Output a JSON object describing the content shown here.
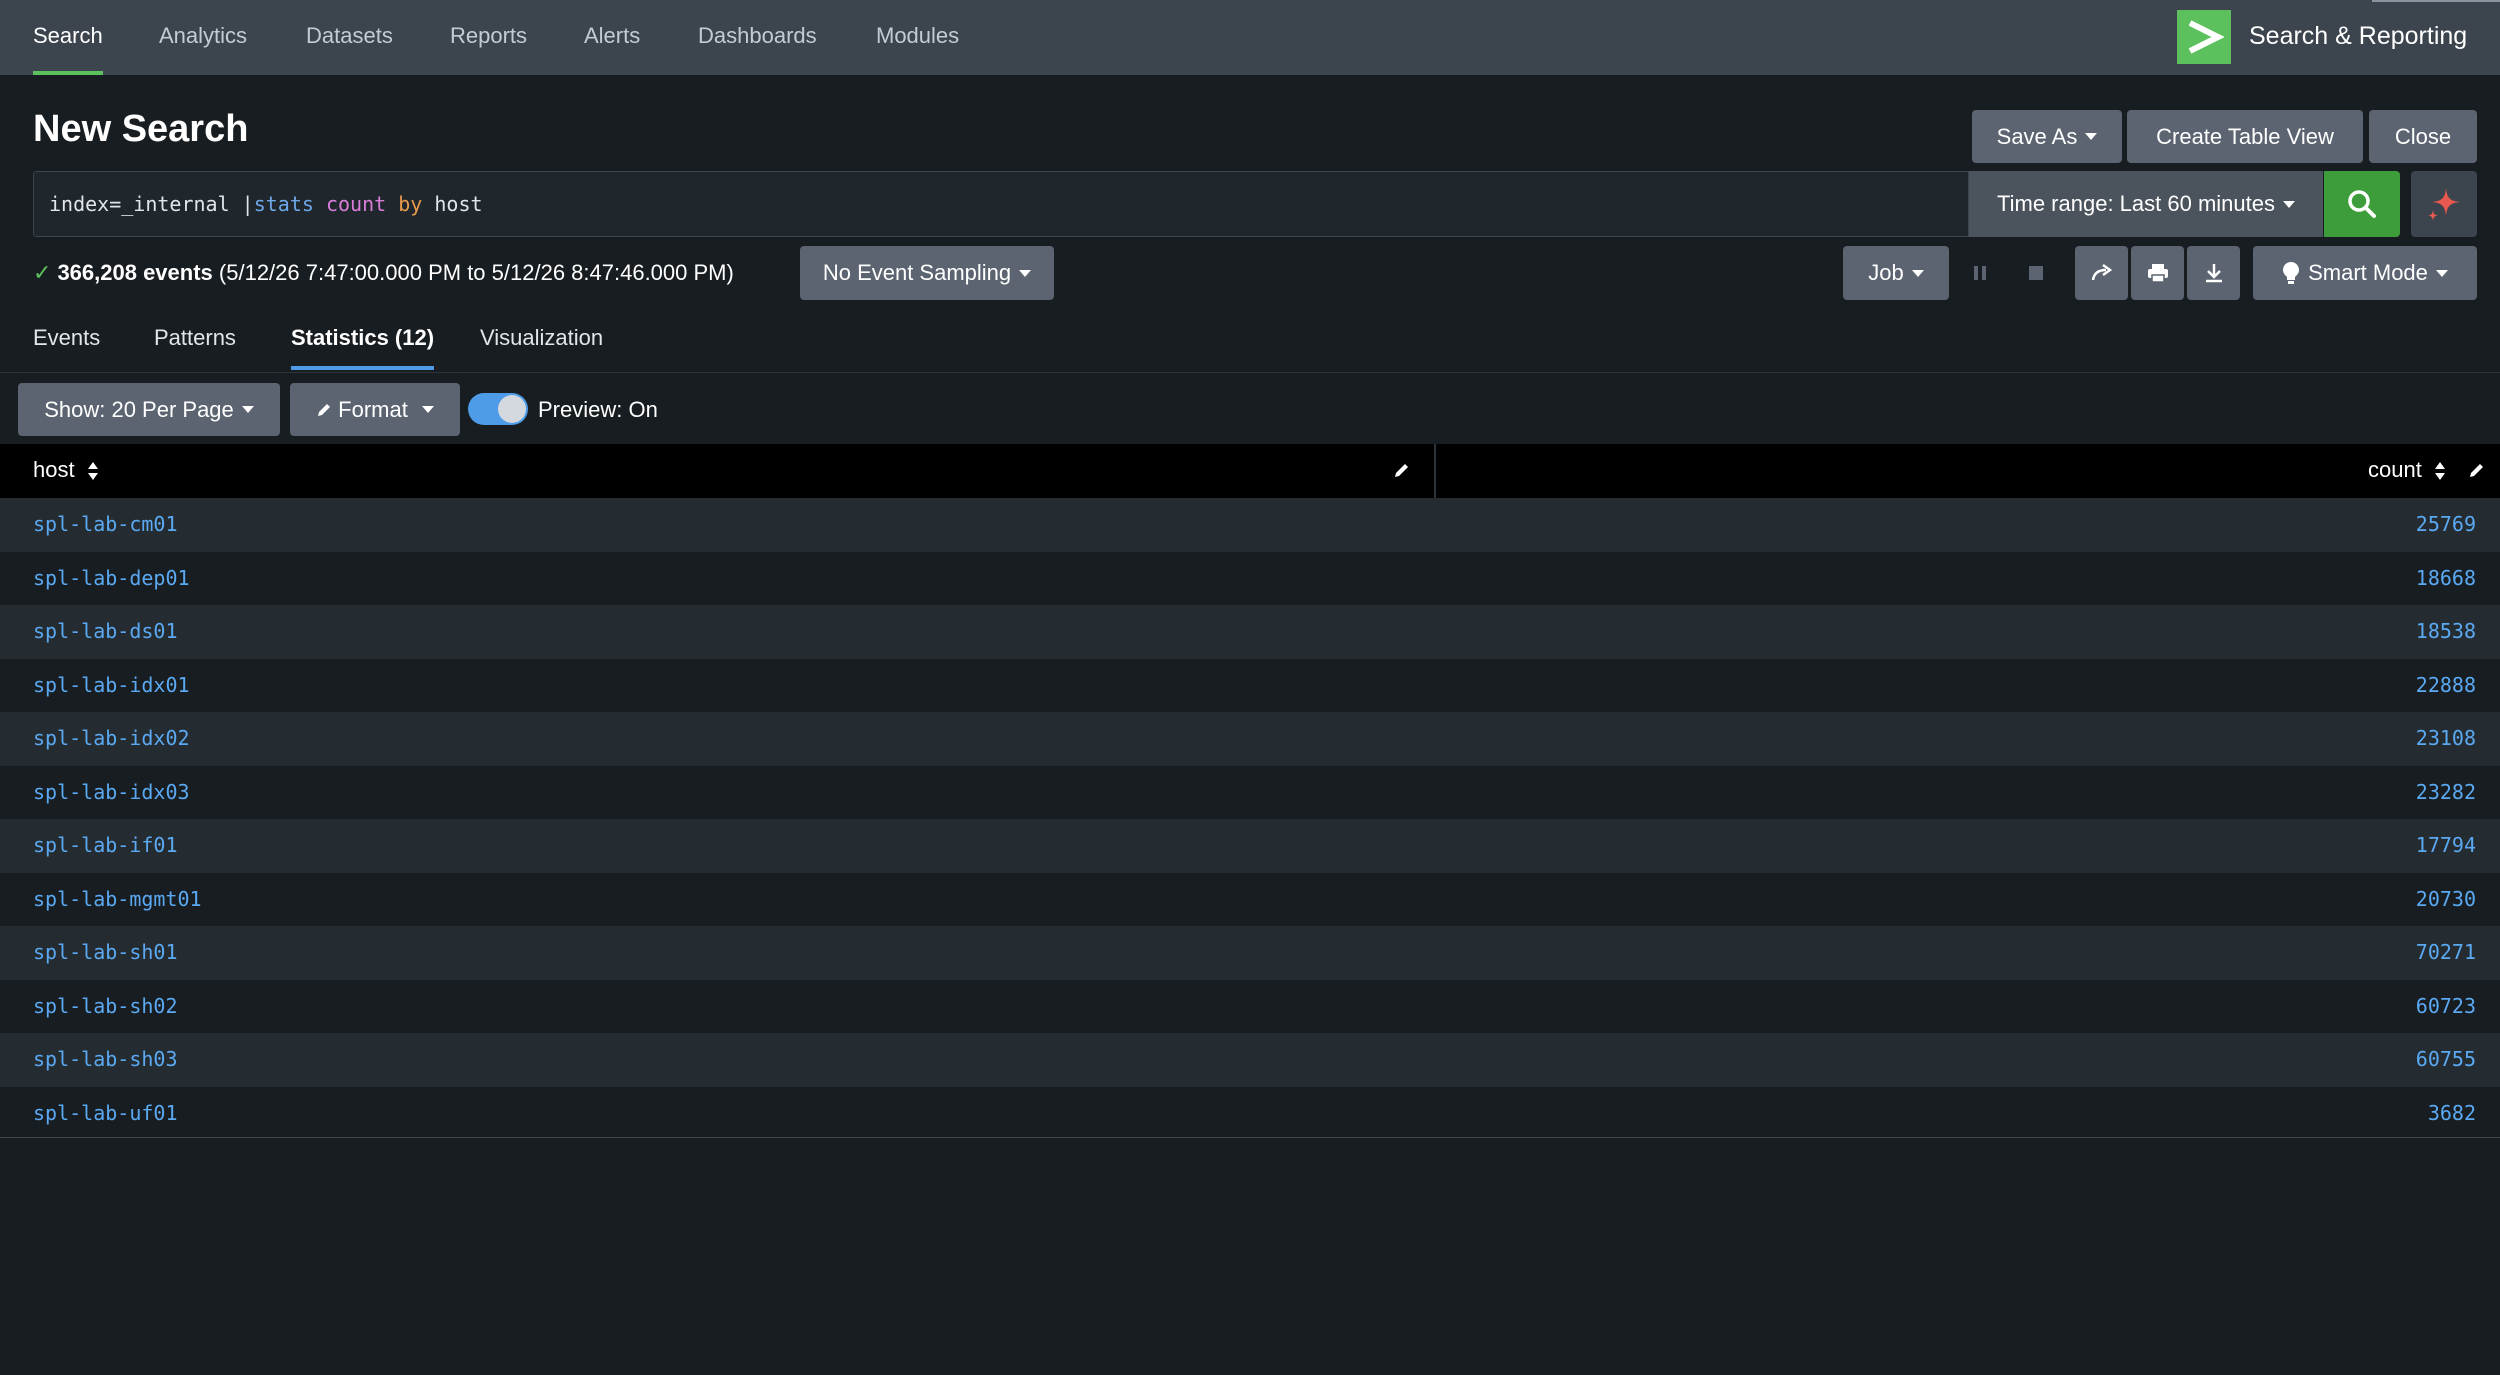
{
  "nav": {
    "items": [
      {
        "label": "Search",
        "active": true
      },
      {
        "label": "Analytics",
        "active": false
      },
      {
        "label": "Datasets",
        "active": false
      },
      {
        "label": "Reports",
        "active": false
      },
      {
        "label": "Alerts",
        "active": false
      },
      {
        "label": "Dashboards",
        "active": false
      },
      {
        "label": "Modules",
        "active": false
      }
    ],
    "app_name": "Search & Reporting"
  },
  "header": {
    "title": "New Search",
    "save_as_label": "Save As",
    "create_table_view_label": "Create Table View",
    "close_label": "Close"
  },
  "search": {
    "query_prefix": "index=_internal |",
    "query_cmd": "stats",
    "query_sp1": " ",
    "query_func": "count",
    "query_sp2": " ",
    "query_by": "by",
    "query_field": " host",
    "time_range_label": "Time range: Last 60 minutes"
  },
  "status": {
    "event_count": "366,208 events",
    "time_span": "(5/12/26 7:47:00.000 PM to 5/12/26 8:47:46.000 PM)",
    "sampling_label": "No Event Sampling",
    "job_label": "Job",
    "mode_label": "Smart Mode"
  },
  "tabs": [
    {
      "label": "Events",
      "active": false
    },
    {
      "label": "Patterns",
      "active": false
    },
    {
      "label": "Statistics (12)",
      "active": true
    },
    {
      "label": "Visualization",
      "active": false
    }
  ],
  "controls": {
    "per_page_label": "Show: 20 Per Page",
    "format_label": "Format",
    "preview_label": "Preview: On",
    "preview_on": true
  },
  "table": {
    "columns": [
      "host",
      "count"
    ],
    "rows": [
      {
        "host": "spl-lab-cm01",
        "count": "25769"
      },
      {
        "host": "spl-lab-dep01",
        "count": "18668"
      },
      {
        "host": "spl-lab-ds01",
        "count": "18538"
      },
      {
        "host": "spl-lab-idx01",
        "count": "22888"
      },
      {
        "host": "spl-lab-idx02",
        "count": "23108"
      },
      {
        "host": "spl-lab-idx03",
        "count": "23282"
      },
      {
        "host": "spl-lab-if01",
        "count": "17794"
      },
      {
        "host": "spl-lab-mgmt01",
        "count": "20730"
      },
      {
        "host": "spl-lab-sh01",
        "count": "70271"
      },
      {
        "host": "spl-lab-sh02",
        "count": "60723"
      },
      {
        "host": "spl-lab-sh03",
        "count": "60755"
      },
      {
        "host": "spl-lab-uf01",
        "count": "3682"
      }
    ]
  },
  "colors": {
    "accent_green": "#5cc05c",
    "accent_blue": "#4e9ce8",
    "link_blue": "#5aa9f2",
    "background": "#171d21"
  },
  "icons": {
    "app_logo": "chevron-right-icon",
    "search": "search-icon",
    "ai": "sparkle-icon",
    "pause": "pause-icon",
    "stop": "stop-icon",
    "share": "share-icon",
    "print": "print-icon",
    "export": "download-icon",
    "mode": "lightbulb-icon",
    "sort": "sort-icon",
    "edit": "pencil-icon"
  }
}
